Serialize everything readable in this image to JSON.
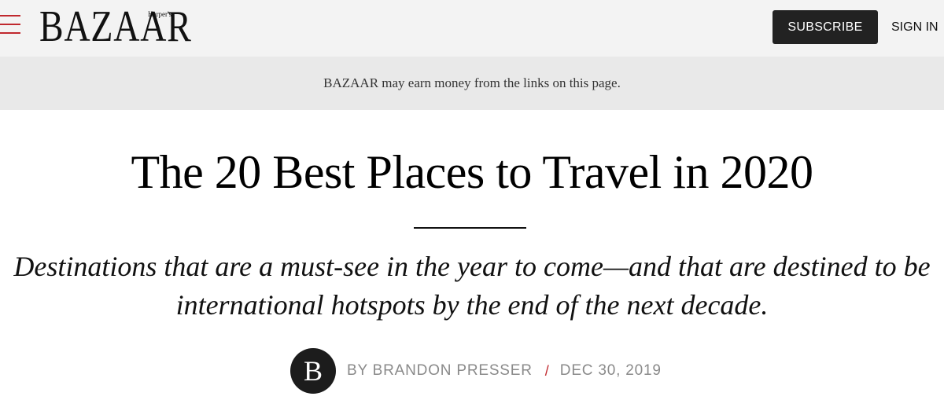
{
  "header": {
    "menu_icon": "hamburger-menu-icon",
    "logo": {
      "main": "BAZAAR",
      "small": "Harper's"
    },
    "subscribe_label": "SUBSCRIBE",
    "signin_label": "SIGN IN"
  },
  "disclaimer": {
    "text": "BAZAAR may earn money from the links on this page."
  },
  "article": {
    "title": "The 20 Best Places to Travel in 2020",
    "dek": "Destinations that are a must-see in the year to come—and that are destined to be international hotspots by the end of the next decade.",
    "author_initial": "B",
    "author": "BY BRANDON PRESSER",
    "separator": "/",
    "date": "DEC 30, 2019"
  },
  "colors": {
    "accent": "#c0282e",
    "header_bg": "#f3f3f3",
    "disclaimer_bg": "#e9e9e9",
    "button_bg": "#222222"
  }
}
